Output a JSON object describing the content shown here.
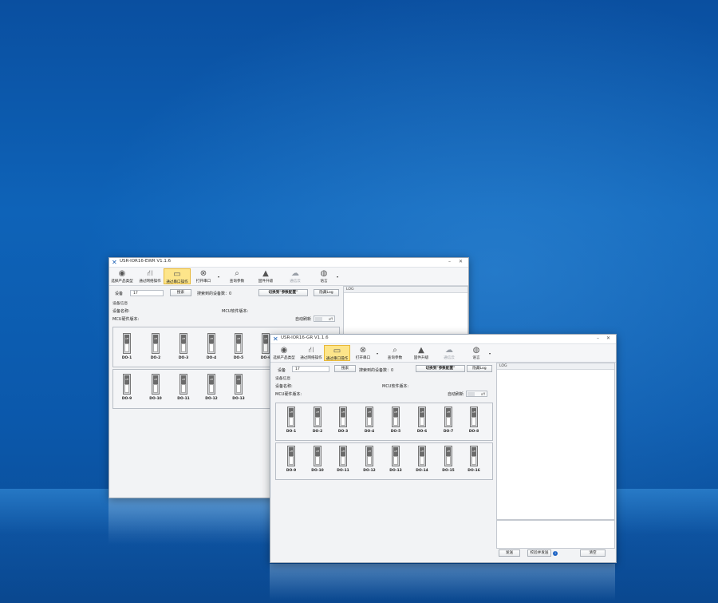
{
  "windows": [
    {
      "title": "USR-IOR16-EWR V1.1.6"
    },
    {
      "title": "USR-IOR16-GR V1.1.6"
    }
  ],
  "toolbar": {
    "select_product": "选择产品类型",
    "via_network": "通过网络操作",
    "via_serial": "通过串口操作",
    "open_serial": "打开串口",
    "query_params": "查询参数",
    "firmware_upgrade": "固件升级",
    "via_cloud": "通信云",
    "language": "语言"
  },
  "device": {
    "label": "设备",
    "address_value": "17",
    "search_button": "搜索",
    "searched_count": "搜索到的设备数：0",
    "switch_config": "切换到\"参数配置\"",
    "hide_log": "隐藏Log"
  },
  "info": {
    "section": "设备信息",
    "device_name": "设备名称:",
    "mcu_software": "MCU软件版本:",
    "mcu_hardware": "MCU硬件版本:",
    "auto_refresh": "自动刷新",
    "toggle_state": "off"
  },
  "switches": {
    "state": "off",
    "row1": [
      "DO-1",
      "DO-2",
      "DO-3",
      "DO-4",
      "DO-5",
      "DO-6",
      "DO-7",
      "DO-8"
    ],
    "row2": [
      "DO-9",
      "DO-10",
      "DO-11",
      "DO-12",
      "DO-13",
      "DO-14",
      "DO-15",
      "DO-16"
    ]
  },
  "log": {
    "header": "LOG",
    "send": "发送",
    "verify_send": "校验并发送",
    "clear": "清空",
    "info_glyph": "i"
  },
  "icons": {
    "logo": "✕",
    "select_product": "◉",
    "via_network": "⛙",
    "via_serial": "▭",
    "open_serial": "⊗",
    "query_params": "⌕",
    "firmware_upgrade": "▲",
    "via_cloud": "☁",
    "language": "◍",
    "caret": "▾"
  },
  "window_controls": {
    "minimize": "–",
    "close": "✕"
  }
}
